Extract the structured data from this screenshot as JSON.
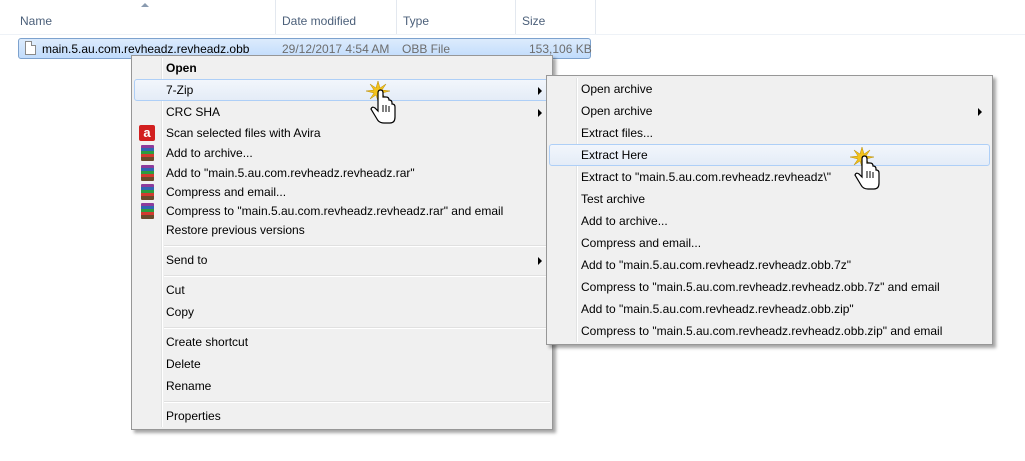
{
  "columns": {
    "name": "Name",
    "date_modified": "Date modified",
    "type": "Type",
    "size": "Size"
  },
  "file": {
    "name": "main.5.au.com.revheadz.revheadz.obb",
    "date": "29/12/2017 4:54 AM",
    "type": "OBB File",
    "size": "153,106 KB"
  },
  "context_menu": {
    "items": [
      {
        "label": "Open",
        "bold": true
      },
      {
        "label": "7-Zip",
        "submenu": true,
        "highlighted": true
      },
      {
        "label": "CRC SHA",
        "submenu": true
      },
      {
        "label": "Scan selected files with Avira",
        "icon": "avira-icon"
      },
      {
        "label": "Add to archive...",
        "icon": "winrar-icon"
      },
      {
        "label": "Add to \"main.5.au.com.revheadz.revheadz.rar\"",
        "icon": "winrar-icon"
      },
      {
        "label": "Compress and email...",
        "icon": "winrar-icon"
      },
      {
        "label": "Compress to \"main.5.au.com.revheadz.revheadz.rar\" and email",
        "icon": "winrar-icon"
      },
      {
        "label": "Restore previous versions"
      },
      {
        "label": "Send to",
        "submenu": true
      },
      {
        "label": "Cut"
      },
      {
        "label": "Copy"
      },
      {
        "label": "Create shortcut"
      },
      {
        "label": "Delete"
      },
      {
        "label": "Rename"
      },
      {
        "label": "Properties"
      }
    ]
  },
  "zip_submenu": {
    "items": [
      {
        "label": "Open archive"
      },
      {
        "label": "Open archive",
        "submenu": true
      },
      {
        "label": "Extract files..."
      },
      {
        "label": "Extract Here",
        "highlighted": true
      },
      {
        "label": "Extract to \"main.5.au.com.revheadz.revheadz\\\""
      },
      {
        "label": "Test archive"
      },
      {
        "label": "Add to archive..."
      },
      {
        "label": "Compress and email..."
      },
      {
        "label": "Add to \"main.5.au.com.revheadz.revheadz.obb.7z\""
      },
      {
        "label": "Compress to \"main.5.au.com.revheadz.revheadz.obb.7z\" and email"
      },
      {
        "label": "Add to \"main.5.au.com.revheadz.revheadz.obb.zip\""
      },
      {
        "label": "Compress to \"main.5.au.com.revheadz.revheadz.obb.zip\" and email"
      }
    ]
  },
  "colors": {
    "selection": "#c1dcfc",
    "menu_bg": "#f0f0f0",
    "hover_border": "#aecff7",
    "avira_red": "#d21f1f"
  },
  "icons": {
    "avira": "avira-icon",
    "winrar": "winrar-icon",
    "cursor": "hand-cursor-icon"
  }
}
